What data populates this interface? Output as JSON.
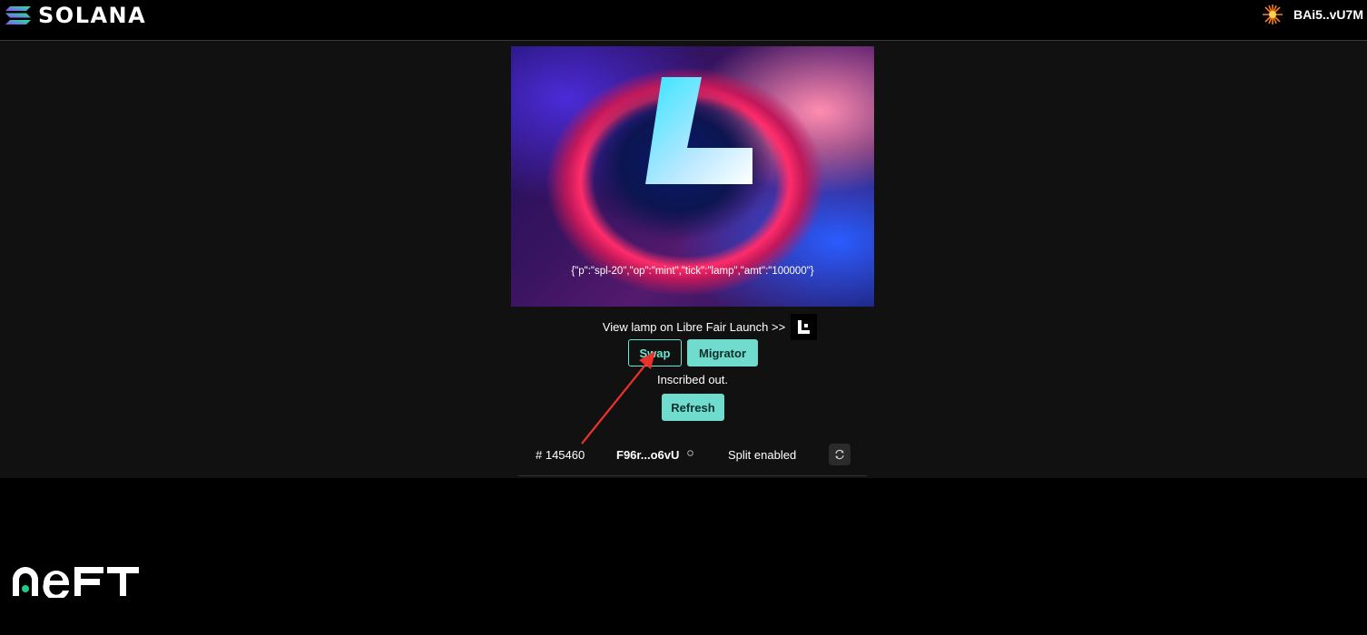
{
  "header": {
    "brand_name": "SOLANA",
    "wallet_address": "BAi5..vU7M",
    "logo_icon": "solana-logo-icon",
    "wallet_icon": "starburst-avatar-icon"
  },
  "artwork": {
    "letter": "L",
    "caption": "{\"p\":\"spl-20\",\"op\":\"mint\",\"tick\":\"lamp\",\"amt\":\"100000\"}"
  },
  "launch": {
    "text": "View lamp on Libre Fair Launch >>",
    "icon": "libre-logo-icon"
  },
  "actions": {
    "swap_label": "Swap",
    "migrator_label": "Migrator",
    "status": "Inscribed out.",
    "refresh_label": "Refresh"
  },
  "info": {
    "number": "# 145460",
    "owner": "F96r...o6vU",
    "split": "Split enabled"
  },
  "footer": {
    "brand_name": "NEFT"
  },
  "colors": {
    "accent": "#6fdccd",
    "background": "#111111",
    "header_bg": "#000000",
    "annotation_arrow": "#e8322a"
  }
}
